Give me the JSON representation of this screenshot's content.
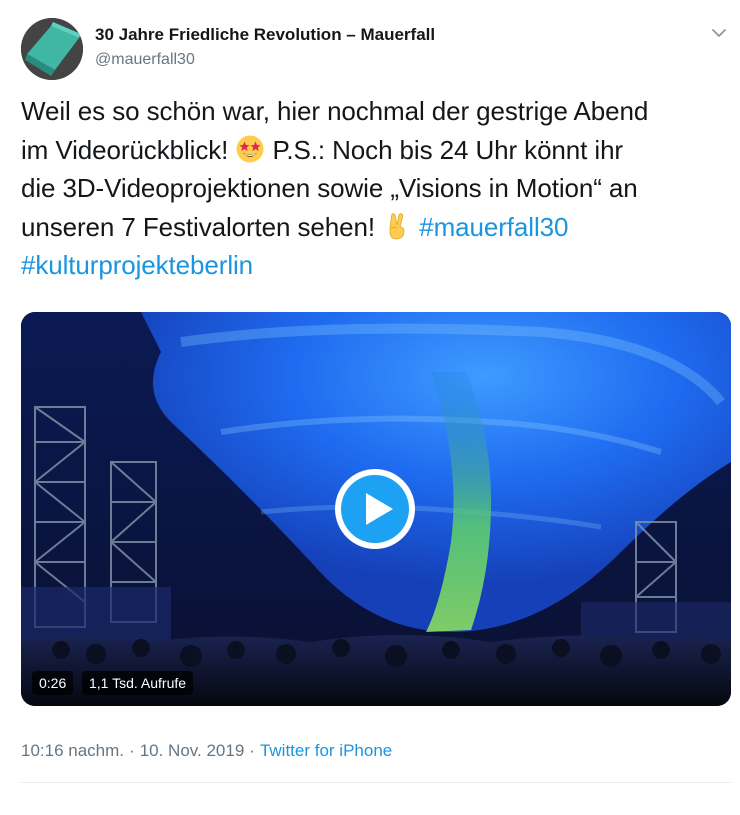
{
  "tweet": {
    "author_name": "30 Jahre Friedliche Revolution – Mauerfall",
    "author_handle": "@mauerfall30",
    "text_lines": [
      "Weil es so schön war, hier nochmal der gestrige Abend",
      "im Videorückblick!",
      "P.S.: Noch bis 24 Uhr könnt ihr",
      "die 3D-Videoprojektionen sowie „Visions in Motion“ an",
      "unseren 7 Festivalorten sehen!"
    ],
    "hashtags": [
      "#mauerfall30",
      "#kulturprojekteberlin"
    ],
    "emojis": [
      "star-struck",
      "victory-hand"
    ]
  },
  "media": {
    "duration": "0:26",
    "views": "1,1 Tsd. Aufrufe"
  },
  "meta": {
    "time": "10:16 nachm.",
    "separator": "·",
    "date": "10. Nov. 2019",
    "source": "Twitter for iPhone"
  },
  "colors": {
    "link": "#1b95e0",
    "muted": "#657786",
    "text": "#14171a",
    "divider": "#e6ecf0"
  }
}
